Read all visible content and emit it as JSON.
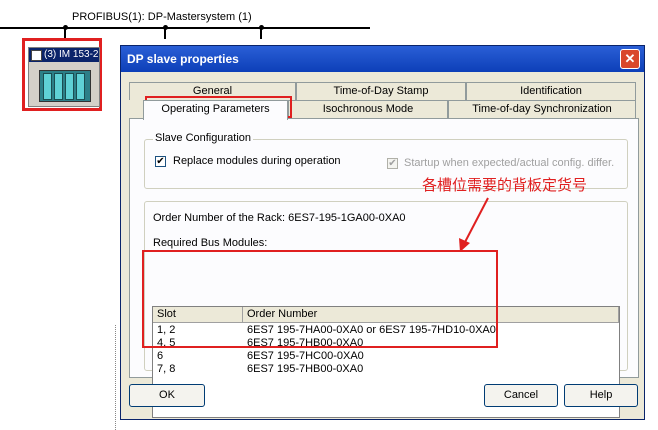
{
  "network": {
    "bus_label": "PROFIBUS(1): DP-Mastersystem (1)",
    "station_label": "(3) IM 153-2"
  },
  "dialog": {
    "title": "DP slave properties",
    "close_label": "✕",
    "tabs_row1": [
      "General",
      "Time-of-Day Stamp",
      "Identification"
    ],
    "tabs_row2": [
      "Operating Parameters",
      "Isochronous Mode",
      "Time-of-day Synchronization"
    ],
    "slave_config": {
      "group_label": "Slave Configuration",
      "replace_label": "Replace modules during operation",
      "replace_checked": "✔",
      "startup_label": "Startup when expected/actual config. differ.",
      "startup_checked": "✔"
    },
    "rack_label": "Order Number of the Rack:",
    "rack_value": "6ES7-195-1GA00-0XA0",
    "bus_modules_label": "Required Bus Modules:",
    "table": {
      "headers": [
        "Slot",
        "Order Number"
      ],
      "rows": [
        {
          "slot": "1, 2",
          "order": "6ES7 195-7HA00-0XA0 or 6ES7 195-7HD10-0XA0"
        },
        {
          "slot": "4, 5",
          "order": "6ES7 195-7HB00-0XA0"
        },
        {
          "slot": "6",
          "order": "6ES7 195-7HC00-0XA0"
        },
        {
          "slot": "7, 8",
          "order": "6ES7 195-7HB00-0XA0"
        }
      ]
    },
    "buttons": {
      "ok": "OK",
      "cancel": "Cancel",
      "help": "Help"
    }
  },
  "annotation": {
    "callout_text": "各槽位需要的背板定货号",
    "color": "#e02020"
  },
  "colors": {
    "titlebar": "#0d3fb8",
    "dialog_bg": "#ece9d8",
    "rack": "#2c7f88"
  }
}
